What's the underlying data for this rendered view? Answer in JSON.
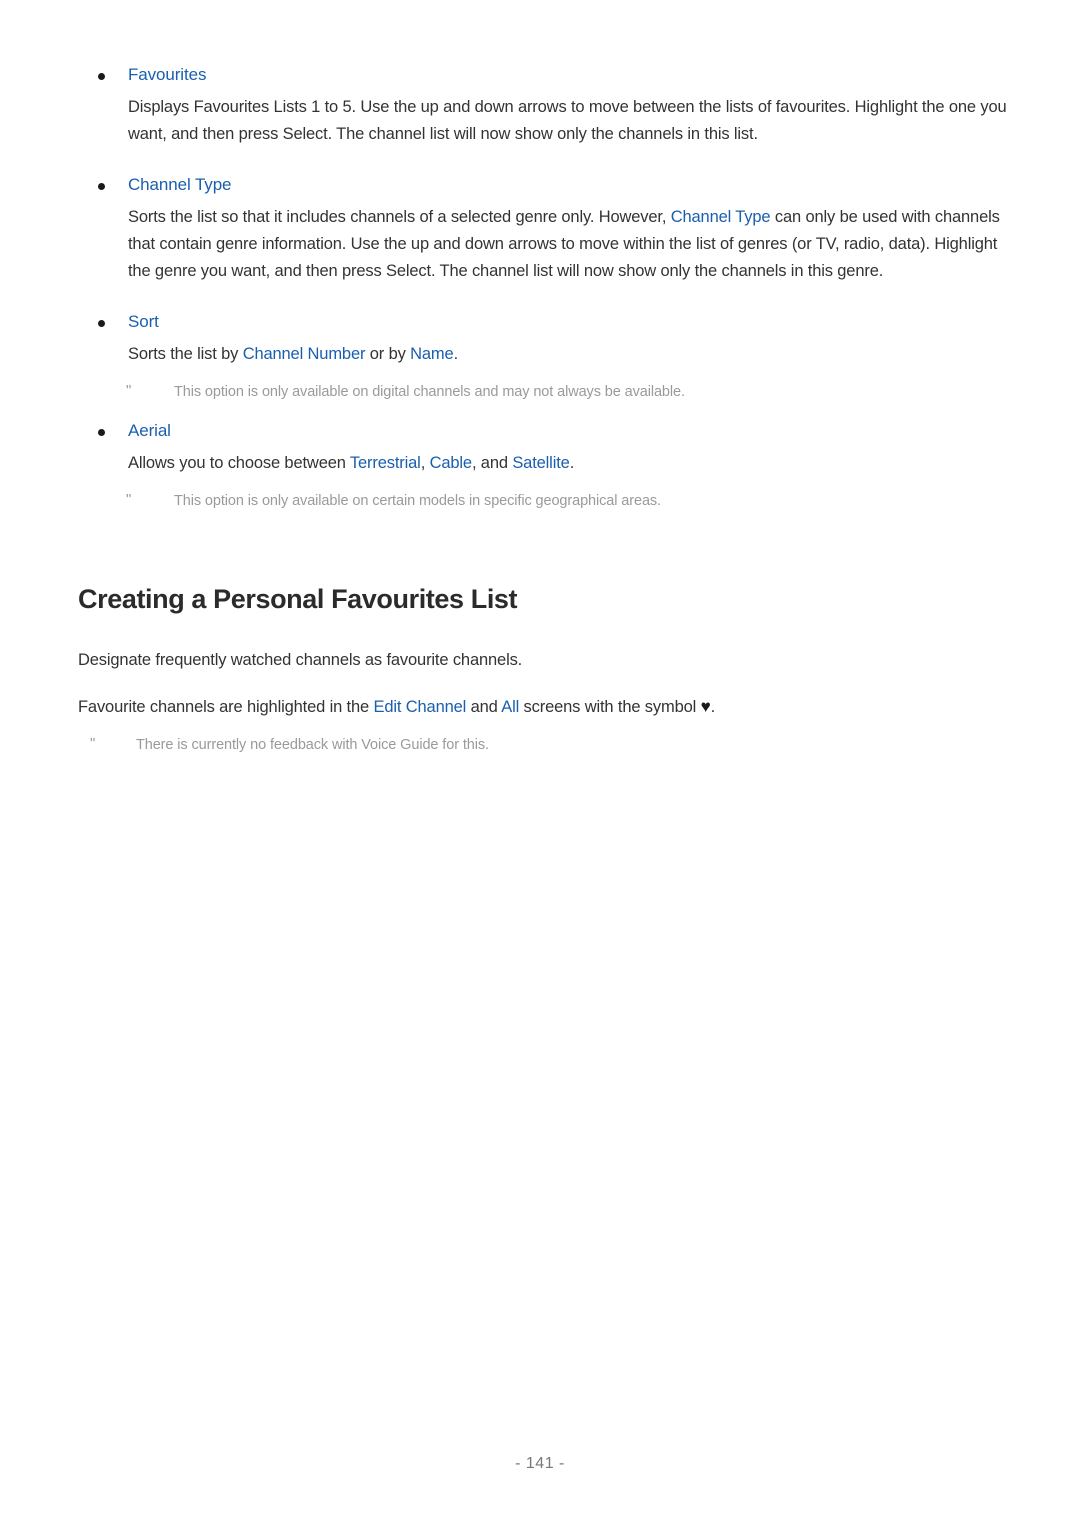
{
  "page": {
    "footer_text": "- 141 -",
    "link_color": "#1a5fae",
    "body_color": "#333333",
    "note_color": "#9a9a9a",
    "heading_color": "#2b2b2b",
    "background": "#ffffff"
  },
  "note_icon": "\"",
  "options": [
    {
      "label": "Favourites",
      "body_1": "Displays Favourites Lists 1 to 5. Use the up and down arrows to move between the lists of favourites. Highlight the one you want, and then press Select. The channel list will now show only the channels in this list."
    },
    {
      "label": "Channel Type",
      "body_pre": "Sorts the list so that it includes channels of a selected genre only. However, ",
      "body_link": "Channel Type",
      "body_post": " can only be used with channels that contain genre information. Use the up and down arrows to move within the list of genres (or TV, radio, data). Highlight the genre you want, and then press Select. The channel list will now show only the channels in this genre."
    },
    {
      "label": "Sort",
      "sort_pre": "Sorts the list by ",
      "sort_link_1": "Channel Number",
      "sort_mid": " or by ",
      "sort_link_2": "Name",
      "sort_post": ".",
      "note": "This option is only available on digital channels and may not always be available."
    },
    {
      "label": "Aerial",
      "aerial_pre": "Allows you to choose between ",
      "aerial_link_1": "Terrestrial",
      "aerial_sep_1": ", ",
      "aerial_link_2": "Cable",
      "aerial_sep_2": ", and ",
      "aerial_link_3": "Satellite",
      "aerial_post": ".",
      "note": "This option is only available on certain models in specific geographical areas."
    }
  ],
  "section": {
    "heading": "Creating a Personal Favourites List",
    "paragraph_1": "Designate frequently watched channels as favourite channels.",
    "paragraph_2_pre": "Favourite channels are highlighted in the ",
    "paragraph_2_link_1": "Edit Channel",
    "paragraph_2_mid": " and ",
    "paragraph_2_link_2": "All",
    "paragraph_2_post": " screens with the symbol ",
    "heart_symbol": "♥",
    "paragraph_2_end": ".",
    "note": "There is currently no feedback with Voice Guide for this."
  }
}
